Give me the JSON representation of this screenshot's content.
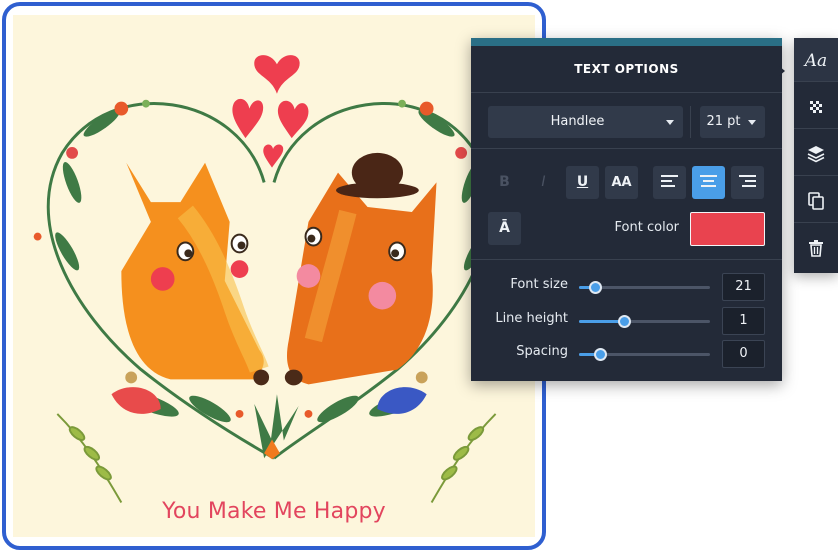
{
  "canvas": {
    "caption": "You Make Me Happy",
    "colors": {
      "background": "#fdf6dc",
      "caption": "#e2455e",
      "frame": "#2f5fd0",
      "fox_left": "#f5901e",
      "fox_right": "#e8701a",
      "heart": "#ee3e4f",
      "leaf": "#3f7a45"
    }
  },
  "text_options": {
    "title": "TEXT OPTIONS",
    "font_family": "Handlee",
    "font_size_select": "21 pt",
    "format_buttons": {
      "bold": "B",
      "italic": "I",
      "underline": "U",
      "all_caps": "AA",
      "effect": "Ā"
    },
    "align_selected": "center",
    "font_color_label": "Font color",
    "font_color": "#e9434f",
    "sliders": {
      "font_size": {
        "label": "Font size",
        "value": "21",
        "level": 0.12
      },
      "line_height": {
        "label": "Line height",
        "value": "1",
        "level": 0.34
      },
      "spacing": {
        "label": "Spacing",
        "value": "0",
        "level": 0.16
      }
    }
  },
  "toolrail": {
    "active": "text",
    "tools": [
      "text-icon",
      "transparency-icon",
      "layers-icon",
      "duplicate-icon",
      "trash-icon"
    ],
    "text_tool_label": "Aa"
  }
}
